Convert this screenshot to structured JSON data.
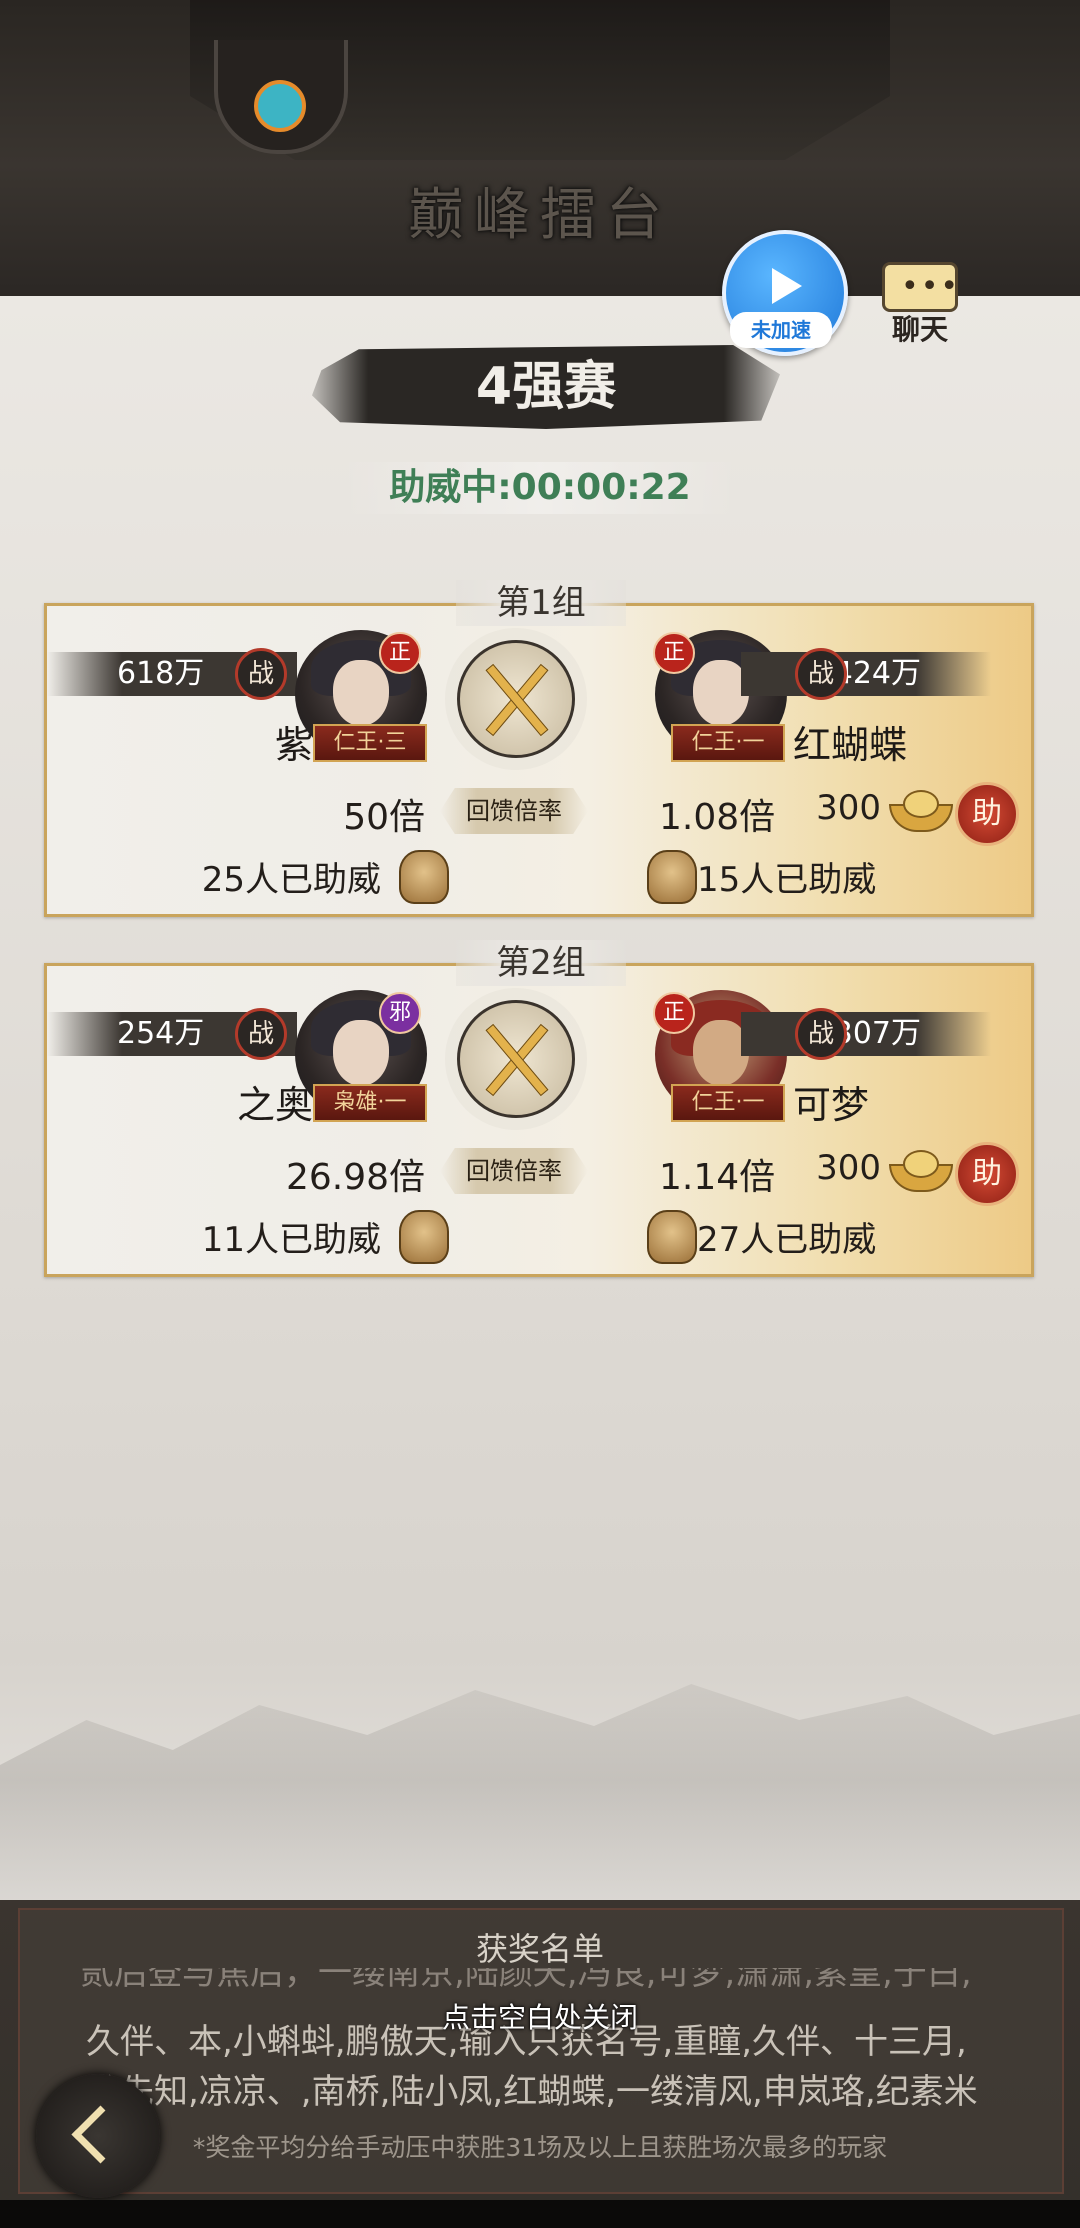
{
  "header": {
    "title": "巅峰擂台"
  },
  "speed_button": {
    "label": "未加速"
  },
  "chat_button": {
    "dots": "•••",
    "label": "聊天"
  },
  "round": {
    "title": "4强赛",
    "countdown": "助威中:00:00:22"
  },
  "odds_label": "回馈倍率",
  "groups": [
    {
      "label": "第1组",
      "left": {
        "power": "618万",
        "zhan": "战",
        "name": "紫皇",
        "badge": "正",
        "rank": "仁王·三",
        "odds": "50倍",
        "cheers": "25人已助威"
      },
      "right": {
        "power": "424万",
        "zhan": "战",
        "name": "红蝴蝶",
        "badge": "正",
        "rank": "仁王·一",
        "odds": "1.08倍",
        "cheers": "15人已助威"
      },
      "bet": {
        "amount": "300",
        "help": "助"
      }
    },
    {
      "label": "第2组",
      "left": {
        "power": "254万",
        "zhan": "战",
        "name": "之奥趙",
        "badge": "邪",
        "rank": "枭雄·一",
        "odds": "26.98倍",
        "cheers": "11人已助威"
      },
      "right": {
        "power": "307万",
        "zhan": "战",
        "name": "可梦",
        "badge": "正",
        "rank": "仁王·一",
        "odds": "1.14倍",
        "cheers": "27人已助威"
      },
      "bet": {
        "amount": "300",
        "help": "助"
      }
    }
  ],
  "winners": {
    "title": "获奖名单",
    "partial_line": "贰后登与焦后，一缕南京,陆颜夭,冯良,可梦,潇潇,紫皇,于白,",
    "line2": "久伴、本,小蝌蚪,鹏傲天,输入只获名号,重瞳,久伴、十三月,",
    "line3": "谁先知,凉凉、,南桥,陆小凤,红蝴蝶,一缕清风,申岚珞,纪素米"
  },
  "close_hint": "点击空白处关闭",
  "prize_note": "*奖金平均分给手动压中获胜31场及以上且获胜场次最多的玩家",
  "colors": {
    "accent_green": "#3f7f56",
    "card_gold": "#c9a45c",
    "help_red": "#b9241c",
    "speed_blue": "#1f78d8"
  }
}
